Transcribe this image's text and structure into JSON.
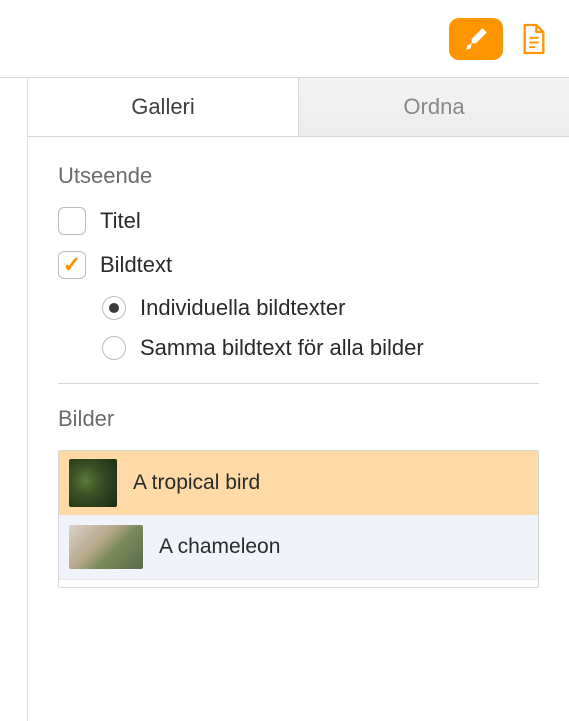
{
  "toolbar": {
    "brush_icon": "brush-icon",
    "document_icon": "document-icon"
  },
  "tabs": {
    "gallery": "Galleri",
    "arrange": "Ordna"
  },
  "appearance": {
    "section_title": "Utseende",
    "title_label": "Titel",
    "title_checked": false,
    "caption_label": "Bildtext",
    "caption_checked": true,
    "radios": {
      "individual": "Individuella bildtexter",
      "same": "Samma bildtext för alla bilder",
      "selected": "individual"
    }
  },
  "images": {
    "section_title": "Bilder",
    "items": [
      {
        "label": "A tropical bird",
        "selected": true
      },
      {
        "label": "A chameleon",
        "selected": false
      }
    ]
  },
  "colors": {
    "accent": "#ff9500",
    "selection": "#ffdaa6"
  }
}
